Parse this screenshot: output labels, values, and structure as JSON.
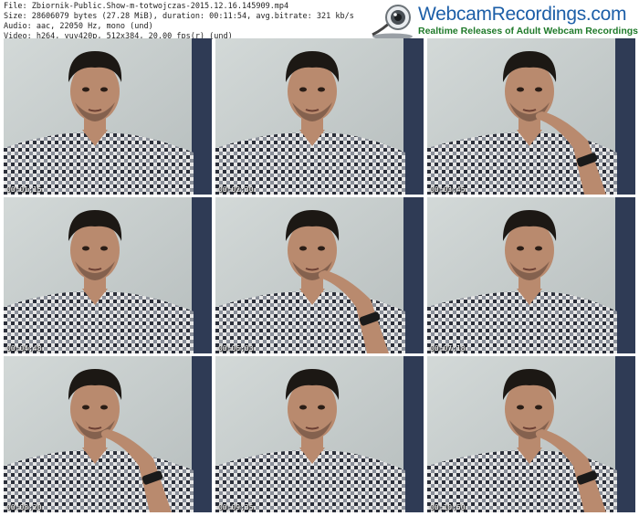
{
  "meta": {
    "file": "File: Zbiornik-Public.Show-m-totwojczas-2015.12.16.145909.mp4",
    "size": "Size: 28606079 bytes (27.28 MiB), duration: 00:11:54, avg.bitrate: 321 kb/s",
    "audio": "Audio: aac, 22050 Hz, mono (und)",
    "video": "Video: h264, yuv420p, 512x384, 20.00 fps(r) (und)"
  },
  "logo": {
    "brand": "WebcamRecordings.com",
    "tagline": "Realtime Releases of Adult Webcam Recordings",
    "icon": "webcam-icon"
  },
  "thumbnails": [
    {
      "timestamp": "00:01:15",
      "pose": "neutral"
    },
    {
      "timestamp": "00:02:30",
      "pose": "neutral"
    },
    {
      "timestamp": "00:03:45",
      "pose": "hand-on-chin"
    },
    {
      "timestamp": "00:04:48",
      "pose": "neutral"
    },
    {
      "timestamp": "00:06:03",
      "pose": "hand-on-chin"
    },
    {
      "timestamp": "00:07:18",
      "pose": "neutral"
    },
    {
      "timestamp": "00:08:20",
      "pose": "hand-on-chin"
    },
    {
      "timestamp": "00:09:35",
      "pose": "neutral"
    },
    {
      "timestamp": "00:10:50",
      "pose": "hand-on-chin"
    }
  ],
  "colors": {
    "wall": "#c4cccb",
    "skin": "#b98a6e",
    "hair": "#1c1814",
    "shirt_dark": "#2b2f3a",
    "shirt_light": "#e6e6e6",
    "curtain": "#2f3b55"
  }
}
